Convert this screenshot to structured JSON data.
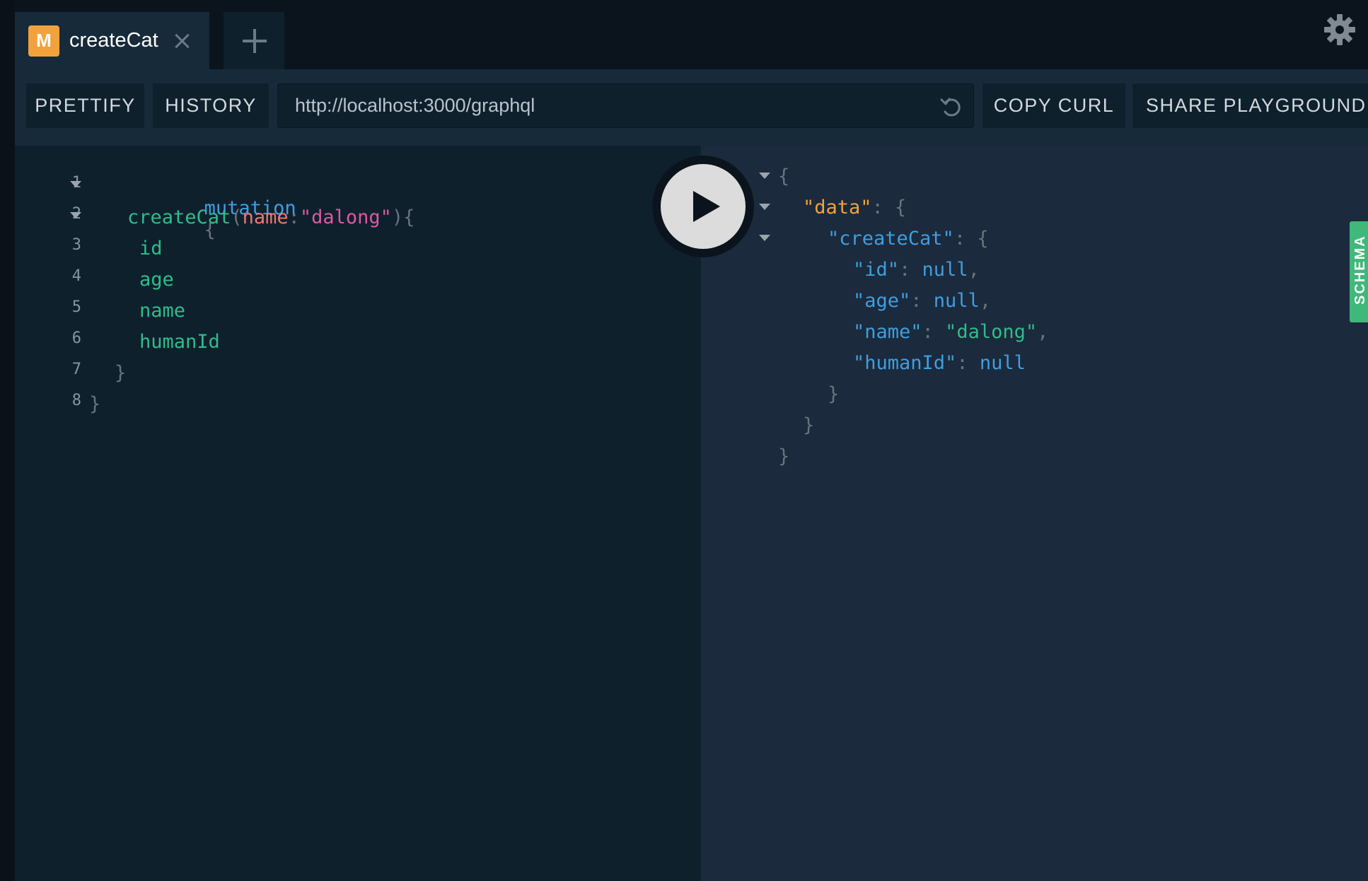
{
  "tab": {
    "badge": "M",
    "title": "createCat"
  },
  "toolbar": {
    "prettify_label": "PRETTIFY",
    "history_label": "HISTORY",
    "url": "http://localhost:3000/graphql",
    "copy_curl_label": "COPY CURL",
    "share_label": "SHARE PLAYGROUND"
  },
  "editor": {
    "line_numbers": [
      "1",
      "2",
      "3",
      "4",
      "5",
      "6",
      "7",
      "8"
    ],
    "keyword": "mutation",
    "open_brace": "{",
    "field": "createCat",
    "open_paren": "(",
    "arg_name": "name",
    "colon": ":",
    "arg_value": "\"dalong\"",
    "close_paren_brace": "){",
    "selections": [
      "id",
      "age",
      "name",
      "humanId"
    ],
    "close_brace": "}"
  },
  "result": {
    "open_brace": "{",
    "data_key": "\"data\"",
    "create_key": "\"createCat\"",
    "colon_brace": ": {",
    "fields": [
      {
        "key": "\"id\"",
        "value": "null",
        "comma": ","
      },
      {
        "key": "\"age\"",
        "value": "null",
        "comma": ","
      },
      {
        "key": "\"name\"",
        "value": "\"dalong\"",
        "comma": ","
      },
      {
        "key": "\"humanId\"",
        "value": "null",
        "comma": ""
      }
    ],
    "close_brace": "}"
  },
  "schema_tab_label": "SCHEMA",
  "colors": {
    "tab_badge": "#f2a23d",
    "keyword": "#3f9ee0",
    "field": "#2fbc8a",
    "argument": "#f0776d",
    "string": "#dd58a3",
    "schema_tab": "#3fb87a"
  },
  "icons": {
    "tab_close": "close-icon",
    "new_tab": "plus-icon",
    "settings": "gear-icon",
    "reload": "reload-icon",
    "execute": "play-icon"
  }
}
